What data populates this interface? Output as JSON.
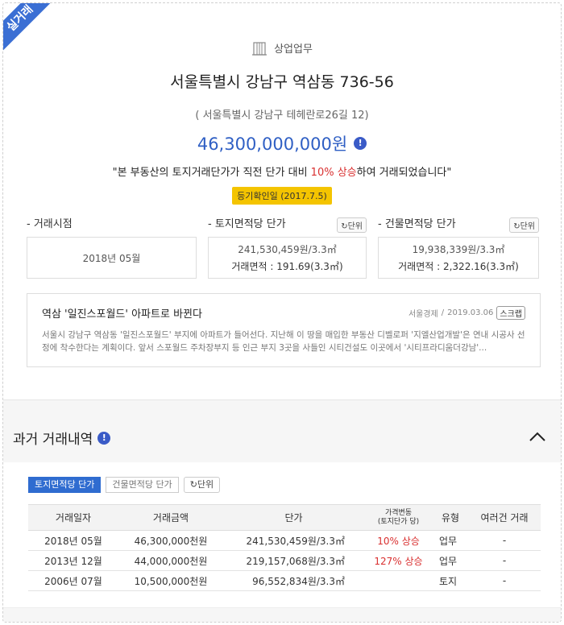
{
  "ribbon": "실거래",
  "header": {
    "category": "상업업무",
    "title": "서울특별시 강남구 역삼동 736-56",
    "road_address": "( 서울특별시 강남구 테헤란로26길 12)",
    "price": "46,300,000,000원",
    "sentence_pre": "\"본 부동산의 토지거래단가가 직전 단가 대비 ",
    "sentence_up": "10% 상승",
    "sentence_post": "하여 거래되었습니다\"",
    "badge": "등기확인일 (2017.7.5)"
  },
  "stats": {
    "date_label": "- 거래시점",
    "date_value": "2018년 05월",
    "land_label": "- 토지면적당 단가",
    "land_price": "241,530,459원/3.3㎡",
    "land_area": "거래면적 : 191.69(3.3㎡)",
    "bldg_label": "- 건물면적당 단가",
    "bldg_price": "19,938,339원/3.3㎡",
    "bldg_area": "거래면적 : 2,322.16(3.3㎡)",
    "unit_label": "단위"
  },
  "news": {
    "title": "역삼 '일진스포월드' 아파트로 바뀐다",
    "source": "서울경제",
    "sep": "/",
    "date": "2019.03.06",
    "scrap": "스크랩",
    "body": "서울시 강남구 역삼동 '일진스포월드' 부지에 아파트가 들어선다. 지난해 이 땅을 매입한 부동산 디벨로퍼 '지엘산업개발'은 연내 시공사 선정에 착수한다는 계획이다. 앞서 스포월드 주차장부지 등 인근 부지 3곳을 사들인 시티건설도 이곳에서 '시티프라디움더강남'..."
  },
  "history": {
    "title": "과거 거래내역",
    "tabs": [
      "토지면적당 단가",
      "건물면적당 단가"
    ],
    "unit_label": "단위",
    "columns": {
      "date": "거래일자",
      "amount": "거래금액",
      "price": "단가",
      "change1": "가격변동",
      "change2": "(토지단가 당)",
      "type": "유형",
      "multi": "여러건 거래"
    },
    "rows": [
      {
        "date": "2018년 05월",
        "amount": "46,300,000천원",
        "price": "241,530,459원/3.3㎡",
        "change": "10% 상승",
        "type": "업무",
        "multi": "-"
      },
      {
        "date": "2013년 12월",
        "amount": "44,000,000천원",
        "price": "219,157,068원/3.3㎡",
        "change": "127% 상승",
        "type": "업무",
        "multi": "-"
      },
      {
        "date": "2006년 07월",
        "amount": "10,500,000천원",
        "price": "96,552,834원/3.3㎡",
        "change": "",
        "type": "토지",
        "multi": "-"
      }
    ]
  },
  "colors": {
    "accent": "#2f6cd0",
    "up": "#d93030",
    "badge": "#f4c400"
  }
}
